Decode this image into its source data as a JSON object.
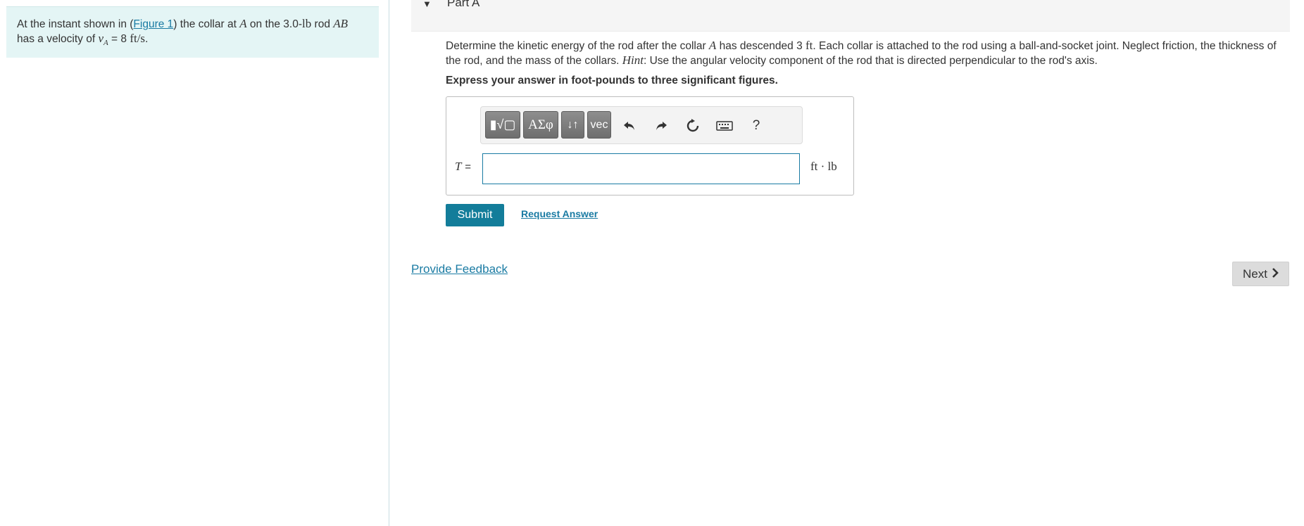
{
  "intro": {
    "text_before_link": "At the instant shown in (",
    "figure_link": "Figure 1",
    "text_mid1": ") the collar at ",
    "var_A": "A",
    "text_mid2": " on the 3.0-",
    "unit_lb": "lb",
    "text_mid3": " rod ",
    "var_AB": "AB",
    "line2_start": "has a velocity of ",
    "var_v": "v",
    "var_v_sub": "A",
    "line2_eq": " = 8 ",
    "unit_fts": "ft/s",
    "line2_end": "."
  },
  "part": {
    "title": "Part A"
  },
  "question": {
    "seg1": "Determine the kinetic energy of the rod after the collar ",
    "var_A": "A",
    "seg2": " has descended 3 ",
    "unit_ft": "ft",
    "seg3": ". Each collar is attached to the rod using a ball-and-socket joint. Neglect friction, the thickness of the rod, and the mass of the collars. ",
    "hint_word": "Hint",
    "seg4": ": Use the angular velocity component of the rod that is directed perpendicular to the rod's axis."
  },
  "instruction": "Express your answer in foot-pounds to three significant figures.",
  "toolbar": {
    "templates_label": "▮√▢",
    "greek_label": "ΑΣφ",
    "arrows_label": "↓↑",
    "vec_label": "vec",
    "help_label": "?"
  },
  "answer": {
    "variable": "T",
    "equals": "=",
    "value": "",
    "placeholder": "",
    "unit": "ft · lb"
  },
  "actions": {
    "submit": "Submit",
    "request_answer": "Request Answer",
    "provide_feedback": "Provide Feedback",
    "next": "Next"
  },
  "colors": {
    "accent": "#137d9a",
    "link": "#1a7ba3",
    "intro_bg": "#e4f5f5"
  }
}
